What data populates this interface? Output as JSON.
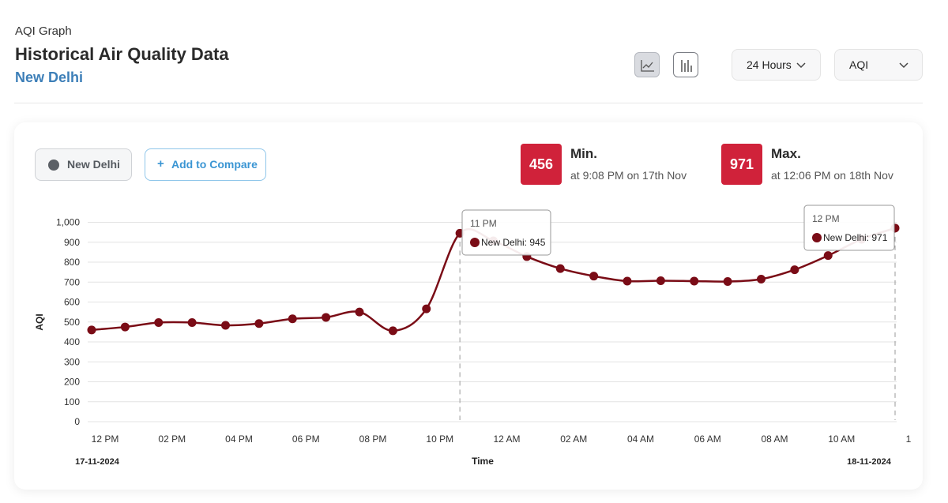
{
  "header": {
    "label": "AQI Graph",
    "title": "Historical Air Quality Data",
    "city": "New Delhi"
  },
  "toolbar": {
    "line_chart_icon": "line-chart-icon",
    "bar_chart_icon": "bar-chart-icon",
    "time_range": "24 Hours",
    "metric": "AQI"
  },
  "compare": {
    "location_chip": "New Delhi",
    "add_button": "Add to Compare",
    "add_icon": "+"
  },
  "stats": {
    "min": {
      "value": "456",
      "label": "Min.",
      "detail": "at 9:08 PM on 17th Nov"
    },
    "max": {
      "value": "971",
      "label": "Max.",
      "detail": "at 12:06 PM on 18th Nov"
    }
  },
  "colors": {
    "series": "#7a0c16",
    "badge": "#d0223a",
    "accent": "#3d7fb8"
  },
  "chart_data": {
    "type": "line",
    "ylabel": "AQI",
    "xlabel": "Time",
    "ylim": [
      0,
      1000
    ],
    "yticks": [
      "0",
      "100",
      "200",
      "300",
      "400",
      "500",
      "600",
      "700",
      "800",
      "900",
      "1,000"
    ],
    "grid": true,
    "x_ticks": [
      {
        "hour": 0,
        "label": "12 PM"
      },
      {
        "hour": 2,
        "label": "02 PM"
      },
      {
        "hour": 4,
        "label": "04 PM"
      },
      {
        "hour": 6,
        "label": "06 PM"
      },
      {
        "hour": 8,
        "label": "08 PM"
      },
      {
        "hour": 10,
        "label": "10 PM"
      },
      {
        "hour": 12,
        "label": "12 AM"
      },
      {
        "hour": 14,
        "label": "02 AM"
      },
      {
        "hour": 16,
        "label": "04 AM"
      },
      {
        "hour": 18,
        "label": "06 AM"
      },
      {
        "hour": 20,
        "label": "08 AM"
      },
      {
        "hour": 22,
        "label": "10 AM"
      },
      {
        "hour": 24,
        "label": "1"
      }
    ],
    "date_start": "17-11-2024",
    "date_end": "18-11-2024",
    "series": [
      {
        "name": "New Delhi",
        "x": [
          0,
          1,
          2,
          3,
          4,
          5,
          6,
          7,
          8,
          9,
          10,
          11,
          12,
          13,
          14,
          15,
          16,
          17,
          18,
          19,
          20,
          21,
          22,
          23,
          24
        ],
        "values": [
          460,
          475,
          497,
          497,
          483,
          492,
          516,
          523,
          550,
          456,
          566,
          945,
          907,
          828,
          768,
          730,
          705,
          707,
          705,
          703,
          715,
          762,
          833,
          915,
          971
        ]
      }
    ],
    "tooltips": [
      {
        "time": "11 PM",
        "text": "New Delhi: 945",
        "index": 11
      },
      {
        "time": "12 PM",
        "text": "New Delhi: 971",
        "index": 24
      }
    ]
  }
}
